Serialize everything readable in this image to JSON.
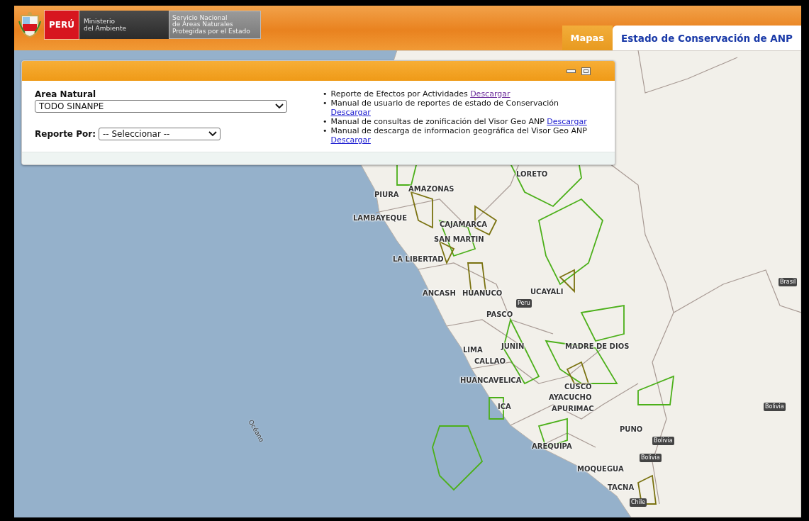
{
  "header": {
    "country": "PERÚ",
    "ministry": [
      "Ministerio",
      "del Ambiente"
    ],
    "service": [
      "Servicio Nacional",
      "de Áreas Naturales",
      "Protegidas por el Estado"
    ]
  },
  "tabs": [
    {
      "label": "Mapas",
      "selected": false
    },
    {
      "label": "Estado de Conservación de ANP",
      "selected": true
    }
  ],
  "panel": {
    "fields": [
      {
        "kind": "stacked",
        "label": "Area Natural",
        "value": "TODO SINANPE"
      },
      {
        "kind": "inline",
        "label": "Reporte Por:",
        "value": "-- Seleccionar --"
      }
    ],
    "downloads": [
      {
        "bullet": "•",
        "text": "Reporte de Efectos por Actividades",
        "link": "Descargar",
        "visited": true
      },
      {
        "bullet": "•",
        "text": "Manual de usuario de reportes de estado de Conservación",
        "link": "Descargar",
        "visited": false
      },
      {
        "bullet": "•",
        "text": "Manual de consultas de zonificación del Visor Geo ANP",
        "link": "Descargar",
        "visited": false
      },
      {
        "bullet": "•",
        "text": "Manual de descarga de informacion geográfica del Visor Geo ANP",
        "link": "Descargar",
        "visited": false
      }
    ]
  },
  "map": {
    "labels": [
      {
        "kind": "region",
        "text": "LORETO"
      },
      {
        "kind": "region",
        "text": "AMAZONAS"
      },
      {
        "kind": "region",
        "text": "PIURA"
      },
      {
        "kind": "region",
        "text": "LAMBAYEQUE"
      },
      {
        "kind": "region",
        "text": "CAJAMARCA"
      },
      {
        "kind": "region",
        "text": "SAN MARTIN"
      },
      {
        "kind": "region",
        "text": "LA LIBERTAD"
      },
      {
        "kind": "region",
        "text": "ANCASH"
      },
      {
        "kind": "region",
        "text": "HUANUCO"
      },
      {
        "kind": "region",
        "text": "UCAYALI"
      },
      {
        "kind": "country",
        "text": "Peru"
      },
      {
        "kind": "region",
        "text": "PASCO"
      },
      {
        "kind": "region",
        "text": "LIMA"
      },
      {
        "kind": "region",
        "text": "JUNIN"
      },
      {
        "kind": "region",
        "text": "MADRE DE DIOS"
      },
      {
        "kind": "region",
        "text": "CALLAO"
      },
      {
        "kind": "region",
        "text": "HUANCAVELICA"
      },
      {
        "kind": "region",
        "text": "CUSCO"
      },
      {
        "kind": "region",
        "text": "ICA"
      },
      {
        "kind": "region",
        "text": "AYACUCHO"
      },
      {
        "kind": "region",
        "text": "APURIMAC"
      },
      {
        "kind": "region",
        "text": "PUNO"
      },
      {
        "kind": "country",
        "text": "Bolivia"
      },
      {
        "kind": "country",
        "text": "Bolivia"
      },
      {
        "kind": "region",
        "text": "AREQUIPA"
      },
      {
        "kind": "region",
        "text": "MOQUEGUA"
      },
      {
        "kind": "region",
        "text": "TACNA"
      },
      {
        "kind": "country",
        "text": "Chile"
      },
      {
        "kind": "country",
        "text": "Brasil"
      },
      {
        "kind": "country",
        "text": "Bolivia"
      },
      {
        "kind": "ocean",
        "text": "Océano"
      }
    ]
  }
}
